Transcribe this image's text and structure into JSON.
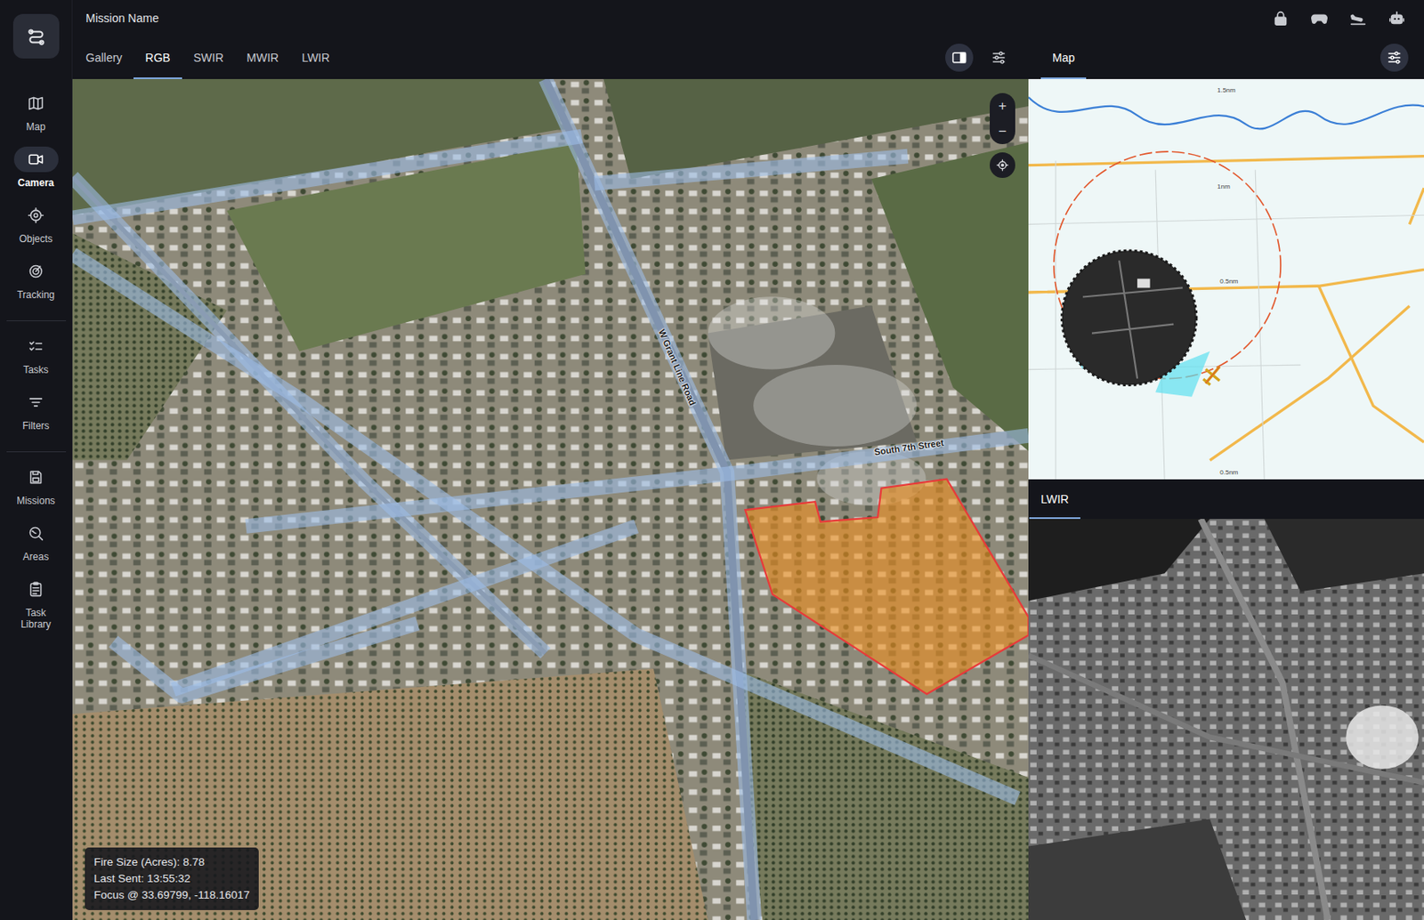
{
  "header": {
    "title": "Mission Name"
  },
  "sidebar": {
    "items": [
      {
        "label": "Map",
        "selected": false
      },
      {
        "label": "Camera",
        "selected": true
      },
      {
        "label": "Objects",
        "selected": false
      },
      {
        "label": "Tracking",
        "selected": false
      },
      {
        "label": "Tasks",
        "selected": false
      },
      {
        "label": "Filters",
        "selected": false
      },
      {
        "label": "Missions",
        "selected": false
      },
      {
        "label": "Areas",
        "selected": false
      },
      {
        "label": "Task Library",
        "selected": false
      }
    ]
  },
  "tabs": [
    {
      "label": "Gallery",
      "selected": false
    },
    {
      "label": "RGB",
      "selected": true
    },
    {
      "label": "SWIR",
      "selected": false
    },
    {
      "label": "MWIR",
      "selected": false
    },
    {
      "label": "LWIR",
      "selected": false
    }
  ],
  "layout_toggle": {
    "on": true
  },
  "camera": {
    "street_labels": [
      "W Grant Line Road",
      "South 7th Street"
    ],
    "zoom": {
      "in": "+",
      "out": "−"
    },
    "info": [
      "Fire Size (Acres): 8.78",
      "Last Sent: 13:55:32",
      "Focus @ 33.69799, -118.16017"
    ]
  },
  "map_panel": {
    "tabs": [
      {
        "label": "Map",
        "selected": true
      }
    ],
    "range_labels": [
      "1.5nm",
      "1nm",
      "0.5nm",
      "0.5nm"
    ]
  },
  "lwir_panel": {
    "tabs": [
      {
        "label": "LWIR",
        "selected": true
      }
    ]
  }
}
